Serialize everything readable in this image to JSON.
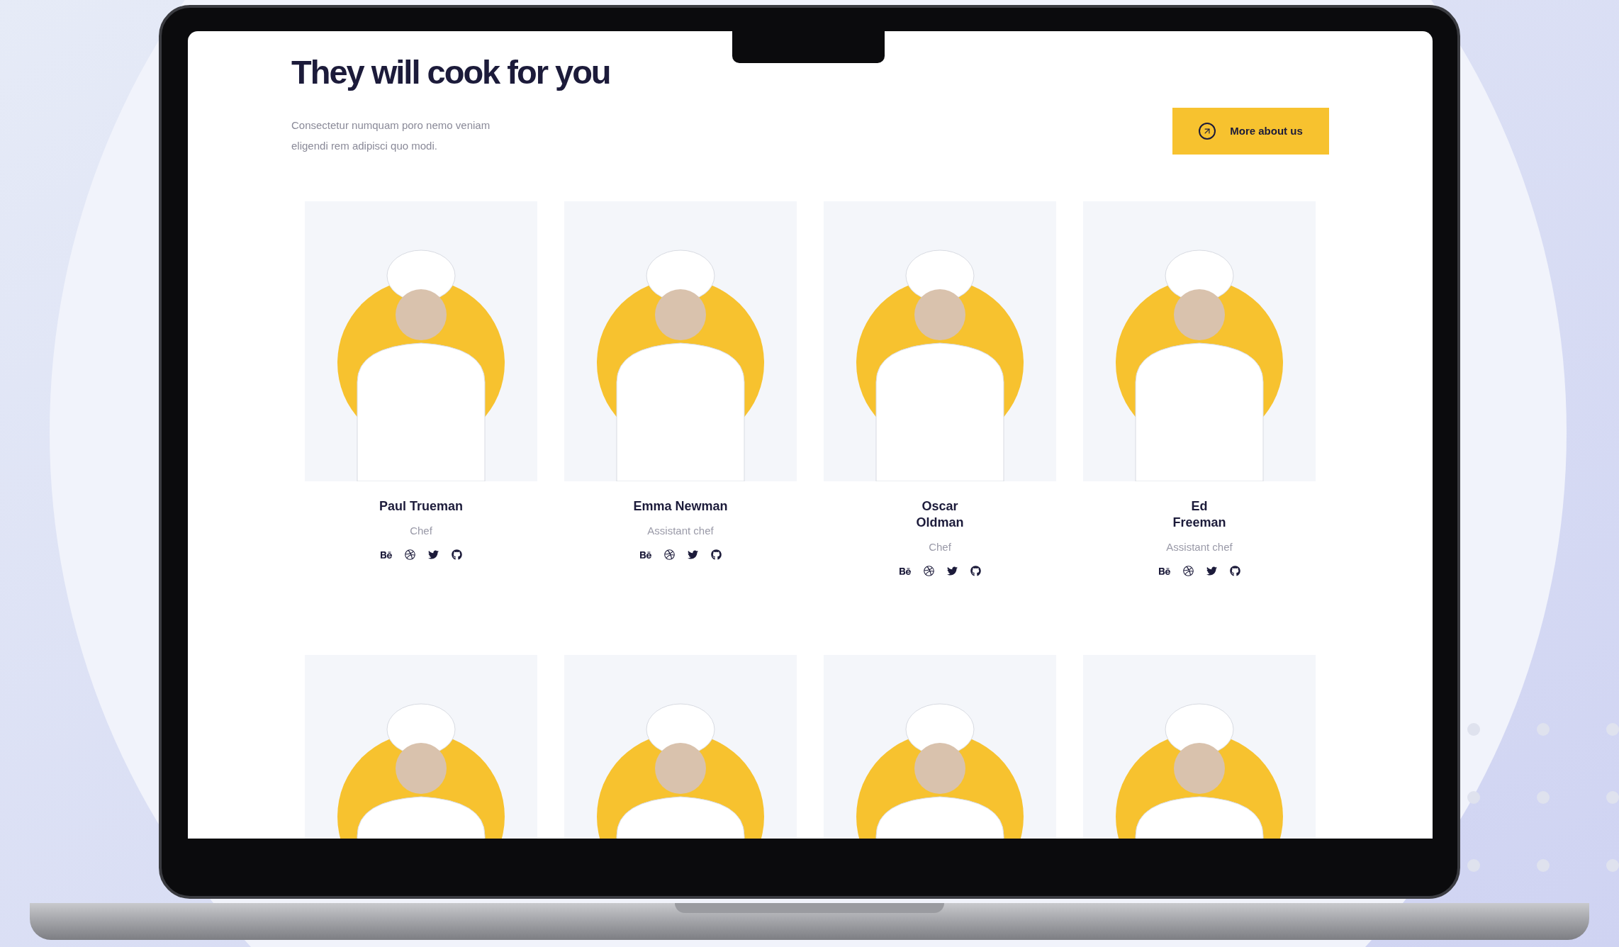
{
  "section": {
    "title": "They will cook for you",
    "description": "Consectetur numquam poro nemo veniam\neligendi rem adipisci quo modi.",
    "button": "More about us"
  },
  "team": [
    {
      "kind": "full",
      "name": "Paul Trueman",
      "role": "Chef"
    },
    {
      "kind": "full",
      "name": "Emma Newman",
      "role": "Assistant chef"
    },
    {
      "kind": "full",
      "name": "Oscar\nOldman",
      "role": "Chef"
    },
    {
      "kind": "full",
      "name": "Ed\nFreeman",
      "role": "Assistant chef"
    },
    {
      "kind": "photo_only"
    },
    {
      "kind": "photo_only"
    },
    {
      "kind": "photo_only"
    },
    {
      "kind": "photo_only"
    }
  ]
}
